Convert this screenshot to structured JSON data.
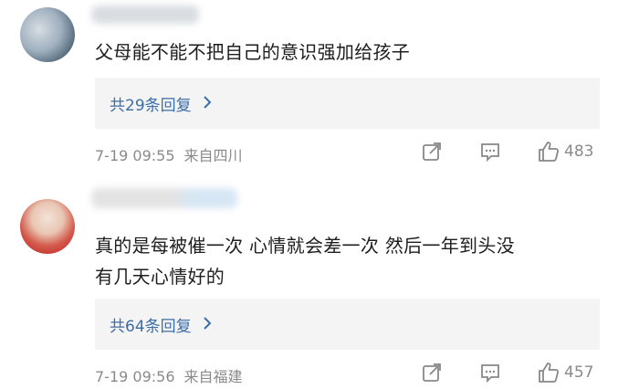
{
  "comments": [
    {
      "text": "父母能不能不把自己的意识强加给孩子",
      "replies_label": "共29条回复",
      "date": "7-19 09:55",
      "location": "来自四川",
      "likes": "483",
      "avatar_icon": "user-avatar"
    },
    {
      "text_line1": "真的是每被催一次 心情就会差一次 然后一年到头没",
      "text_line2": "有几天心情好的",
      "replies_label": "共64条回复",
      "date": "7-19 09:56",
      "location": "来自福建",
      "likes": "457",
      "avatar_icon": "user-avatar"
    }
  ],
  "icons": {
    "share": "share-icon",
    "comment": "comment-icon",
    "like": "thumbs-up-icon",
    "chevron": "chevron-right-icon"
  },
  "colors": {
    "reply_link": "#3c6ea6",
    "meta_text": "#8a8a8a",
    "reply_bg": "#f4f4f4"
  }
}
